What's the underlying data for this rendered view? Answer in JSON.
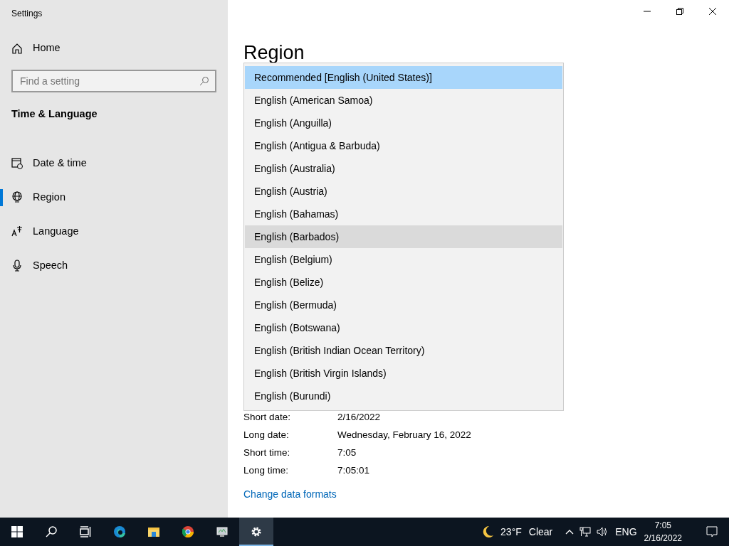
{
  "window": {
    "title": "Settings"
  },
  "sidebar": {
    "home": "Home",
    "search": {
      "placeholder": "Find a setting"
    },
    "section": "Time & Language",
    "items": [
      {
        "label": "Date & time",
        "selected": false
      },
      {
        "label": "Region",
        "selected": true
      },
      {
        "label": "Language",
        "selected": false
      },
      {
        "label": "Speech",
        "selected": false
      }
    ]
  },
  "page": {
    "title": "Region",
    "formats": [
      {
        "label": "Short date:",
        "value": "2/16/2022"
      },
      {
        "label": "Long date:",
        "value": "Wednesday, February 16, 2022"
      },
      {
        "label": "Short time:",
        "value": "7:05"
      },
      {
        "label": "Long time:",
        "value": "7:05:01"
      }
    ],
    "link": "Change data formats"
  },
  "dropdown": {
    "options": [
      {
        "label": "Recommended [English (United States)]",
        "selected": true,
        "hovered": false
      },
      {
        "label": "English (American Samoa)",
        "selected": false,
        "hovered": false
      },
      {
        "label": "English (Anguilla)",
        "selected": false,
        "hovered": false
      },
      {
        "label": "English (Antigua & Barbuda)",
        "selected": false,
        "hovered": false
      },
      {
        "label": "English (Australia)",
        "selected": false,
        "hovered": false
      },
      {
        "label": "English (Austria)",
        "selected": false,
        "hovered": false
      },
      {
        "label": "English (Bahamas)",
        "selected": false,
        "hovered": false
      },
      {
        "label": "English (Barbados)",
        "selected": false,
        "hovered": true
      },
      {
        "label": "English (Belgium)",
        "selected": false,
        "hovered": false
      },
      {
        "label": "English (Belize)",
        "selected": false,
        "hovered": false
      },
      {
        "label": "English (Bermuda)",
        "selected": false,
        "hovered": false
      },
      {
        "label": "English (Botswana)",
        "selected": false,
        "hovered": false
      },
      {
        "label": "English (British Indian Ocean Territory)",
        "selected": false,
        "hovered": false
      },
      {
        "label": "English (British Virgin Islands)",
        "selected": false,
        "hovered": false
      },
      {
        "label": "English (Burundi)",
        "selected": false,
        "hovered": false
      }
    ]
  },
  "taskbar": {
    "apps": [
      {
        "active": false
      },
      {
        "active": false
      },
      {
        "active": false
      },
      {
        "active": false
      },
      {
        "active": false
      },
      {
        "active": false
      },
      {
        "active": false
      },
      {
        "active": true
      }
    ],
    "weather": {
      "temperature": "23°F",
      "condition": "Clear"
    },
    "language": "ENG",
    "time": "7:05",
    "date": "2/16/2022"
  }
}
